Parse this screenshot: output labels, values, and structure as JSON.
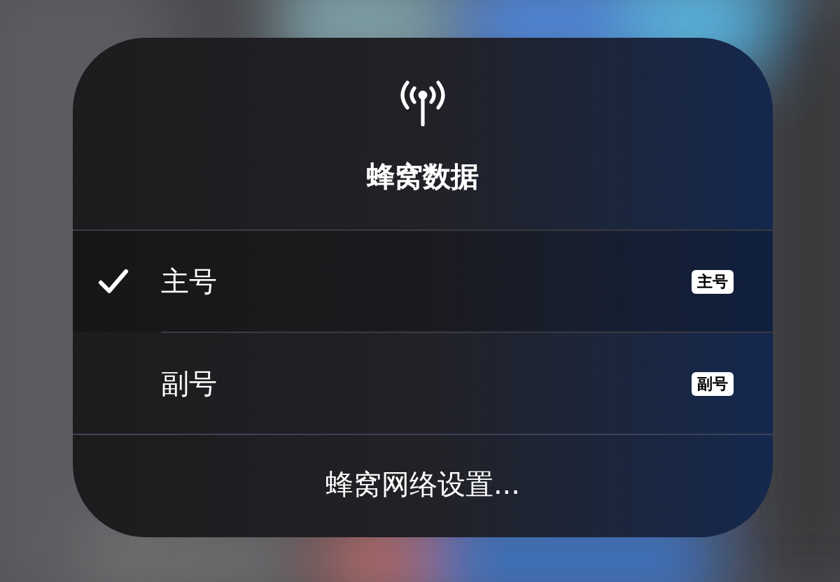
{
  "menu": {
    "title": "蜂窝数据",
    "lines": [
      {
        "label": "主号",
        "badge": "主号",
        "selected": true
      },
      {
        "label": "副号",
        "badge": "副号",
        "selected": false
      }
    ],
    "footer": "蜂窝网络设置..."
  }
}
